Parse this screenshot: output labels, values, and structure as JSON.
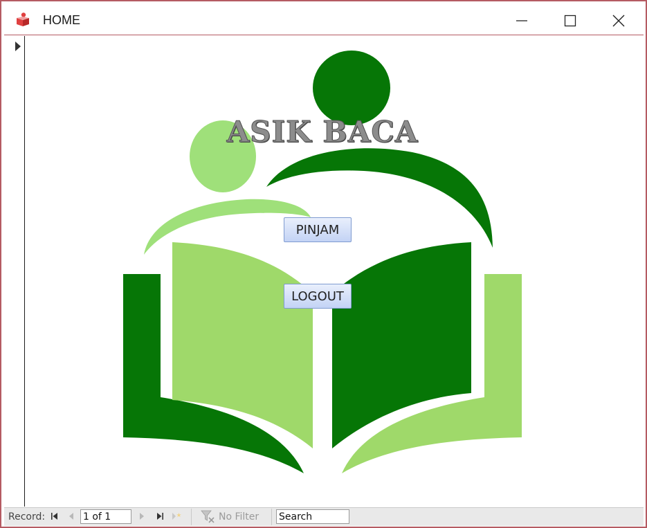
{
  "window": {
    "title": "HOME"
  },
  "form": {
    "logo_text": "ASIK BACA",
    "pinjam_label": "PINJAM",
    "logout_label": "LOGOUT"
  },
  "navbar": {
    "record_label": "Record:",
    "record_position": "1 of 1",
    "filter_label": "No Filter",
    "search_placeholder": "Search"
  },
  "icons": {
    "app": "access-form-icon",
    "minimize": "minimize-icon",
    "maximize": "maximize-icon",
    "close": "close-icon",
    "first": "first-record-icon",
    "prev": "previous-record-icon",
    "next": "next-record-icon",
    "last": "last-record-icon",
    "new": "new-record-icon",
    "filter": "filter-icon"
  },
  "colors": {
    "dark_green": "#067606",
    "light_green": "#9fd96a",
    "frame": "#b55a62",
    "button_border": "#7f9bd0"
  }
}
